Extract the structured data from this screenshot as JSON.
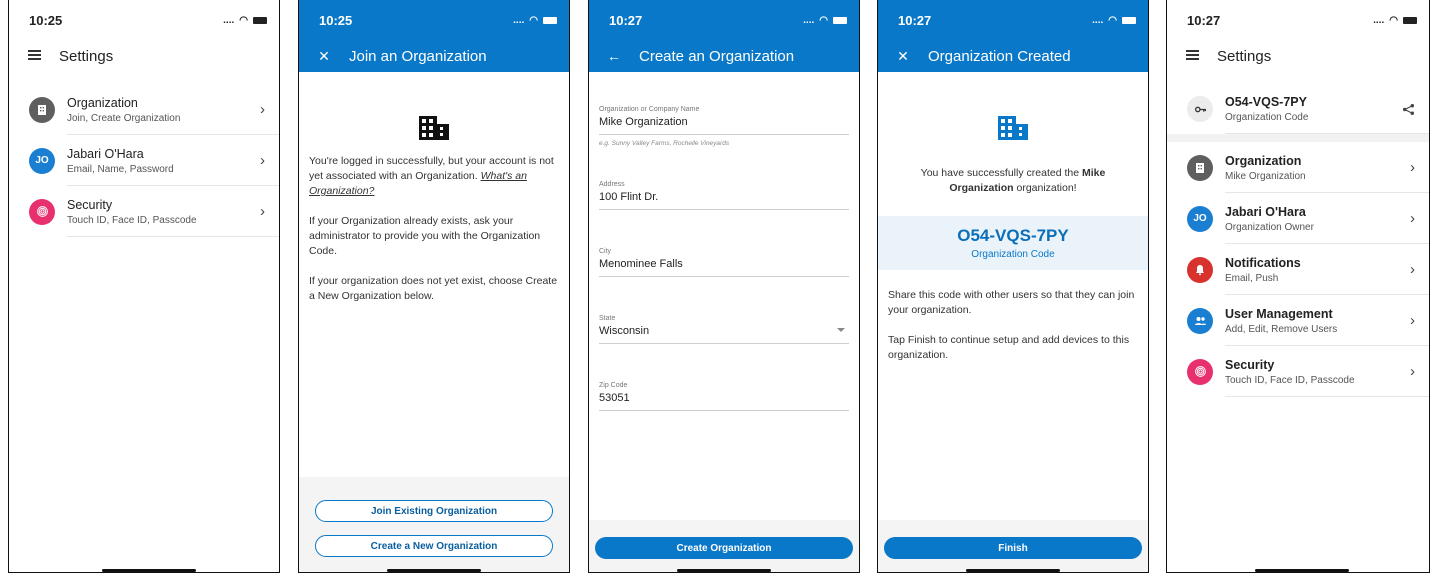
{
  "screens": [
    {
      "status": {
        "time": "10:25",
        "signal": "...."
      },
      "title": "Settings",
      "items": [
        {
          "title": "Organization",
          "subtitle": "Join, Create Organization",
          "avatar": "building-icon",
          "avatar_color": "#5f5f5f"
        },
        {
          "title": "Jabari O'Hara",
          "subtitle": "Email, Name, Password",
          "avatar_text": "JO",
          "avatar_color": "#1a7fd1"
        },
        {
          "title": "Security",
          "subtitle": "Touch ID, Face ID, Passcode",
          "avatar": "fingerprint-icon",
          "avatar_color": "#e8306e"
        }
      ]
    },
    {
      "status": {
        "time": "10:25",
        "signal": "...."
      },
      "title": "Join an Organization",
      "p1_prefix": "You're logged in successfully, but your account is not yet associated with an Organization. ",
      "p1_link": "What's an Organization?",
      "p2": "If your Organization already exists, ask your administrator to provide you with the Organization Code.",
      "p3": "If your organization does not yet exist, choose Create a New Organization below.",
      "btn_join": "Join Existing Organization",
      "btn_create": "Create a New Organization"
    },
    {
      "status": {
        "time": "10:27",
        "signal": "...."
      },
      "title": "Create an Organization",
      "fields": [
        {
          "label": "Organization or Company Name",
          "value": "Mike Organization",
          "hint": "e.g. Sunny Valley Farms, Rochelle Vineyards"
        },
        {
          "label": "Address",
          "value": "100 Flint Dr."
        },
        {
          "label": "City",
          "value": "Menominee Falls"
        },
        {
          "label": "State",
          "value": "Wisconsin"
        },
        {
          "label": "Zip Code",
          "value": "53051"
        }
      ],
      "button": "Create Organization"
    },
    {
      "status": {
        "time": "10:27",
        "signal": "...."
      },
      "title": "Organization Created",
      "msg_prefix": "You have successfully created the ",
      "msg_bold": "Mike Organization",
      "msg_suffix": " organization!",
      "code": "O54-VQS-7PY",
      "code_label": "Organization Code",
      "p1": "Share this code with other users so that they can join your organization.",
      "p2": "Tap Finish to continue setup and add devices to this organization.",
      "button": "Finish"
    },
    {
      "status": {
        "time": "10:27",
        "signal": "...."
      },
      "title": "Settings",
      "code_item": {
        "title": "O54-VQS-7PY",
        "subtitle": "Organization Code"
      },
      "items": [
        {
          "title": "Organization",
          "subtitle": "Mike Organization",
          "avatar": "building-icon",
          "avatar_color": "#5f5f5f"
        },
        {
          "title": "Jabari O'Hara",
          "subtitle": "Organization Owner",
          "avatar_text": "JO",
          "avatar_color": "#1a7fd1"
        },
        {
          "title": "Notifications",
          "subtitle": "Email, Push",
          "avatar": "bell-icon",
          "avatar_color": "#d8322f"
        },
        {
          "title": "User Management",
          "subtitle": "Add, Edit, Remove Users",
          "avatar": "users-icon",
          "avatar_color": "#1a7fd1"
        },
        {
          "title": "Security",
          "subtitle": "Touch ID, Face ID, Passcode",
          "avatar": "fingerprint-icon",
          "avatar_color": "#e8306e"
        }
      ]
    }
  ],
  "colors": {
    "primary": "#0a78c8",
    "code_bg": "#eaf3fa"
  }
}
